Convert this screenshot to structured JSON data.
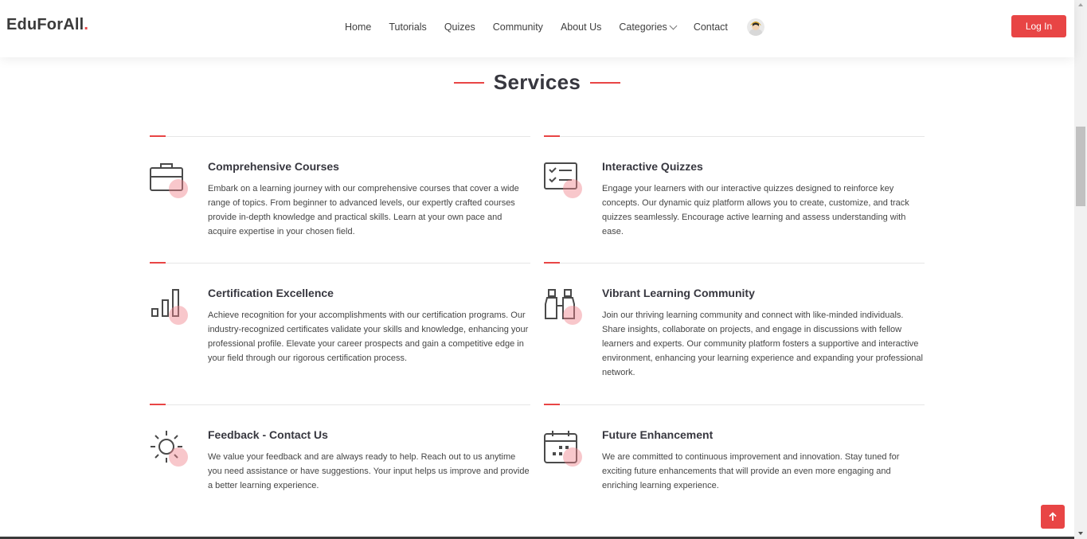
{
  "header": {
    "logo_text": "EduForAll",
    "logo_dot": ".",
    "nav": [
      {
        "label": "Home"
      },
      {
        "label": "Tutorials"
      },
      {
        "label": "Quizes"
      },
      {
        "label": "Community"
      },
      {
        "label": "About Us"
      },
      {
        "label": "Categories"
      },
      {
        "label": "Contact"
      }
    ],
    "login_label": "Log In"
  },
  "section": {
    "title": "Services"
  },
  "services": [
    {
      "title": "Comprehensive Courses",
      "icon": "briefcase-icon",
      "text": "Embark on a learning journey with our comprehensive courses that cover a wide range of topics. From beginner to advanced levels, our expertly crafted courses provide in-depth knowledge and practical skills. Learn at your own pace and acquire expertise in your chosen field."
    },
    {
      "title": "Interactive Quizzes",
      "icon": "checklist-icon",
      "text": "Engage your learners with our interactive quizzes designed to reinforce key concepts. Our dynamic quiz platform allows you to create, customize, and track quizzes seamlessly. Encourage active learning and assess understanding with ease."
    },
    {
      "title": "Certification Excellence",
      "icon": "bar-chart-icon",
      "text": "Achieve recognition for your accomplishments with our certification programs. Our industry-recognized certificates validate your skills and knowledge, enhancing your professional profile. Elevate your career prospects and gain a competitive edge in your field through our rigorous certification process."
    },
    {
      "title": "Vibrant Learning Community",
      "icon": "binoculars-icon",
      "text": "Join our thriving learning community and connect with like-minded individuals. Share insights, collaborate on projects, and engage in discussions with fellow learners and experts. Our community platform fosters a supportive and interactive environment, enhancing your learning experience and expanding your professional network."
    },
    {
      "title": "Feedback - Contact Us",
      "icon": "sun-icon",
      "text": "We value your feedback and are always ready to help. Reach out to us anytime you need assistance or have suggestions. Your input helps us improve and provide a better learning experience."
    },
    {
      "title": "Future Enhancement",
      "icon": "calendar-icon",
      "text": "We are committed to continuous improvement and innovation. Stay tuned for exciting future enhancements that will provide an even more engaging and enriching learning experience."
    }
  ],
  "colors": {
    "accent": "#e84545",
    "heading": "#37373f",
    "body_text": "#454545"
  }
}
